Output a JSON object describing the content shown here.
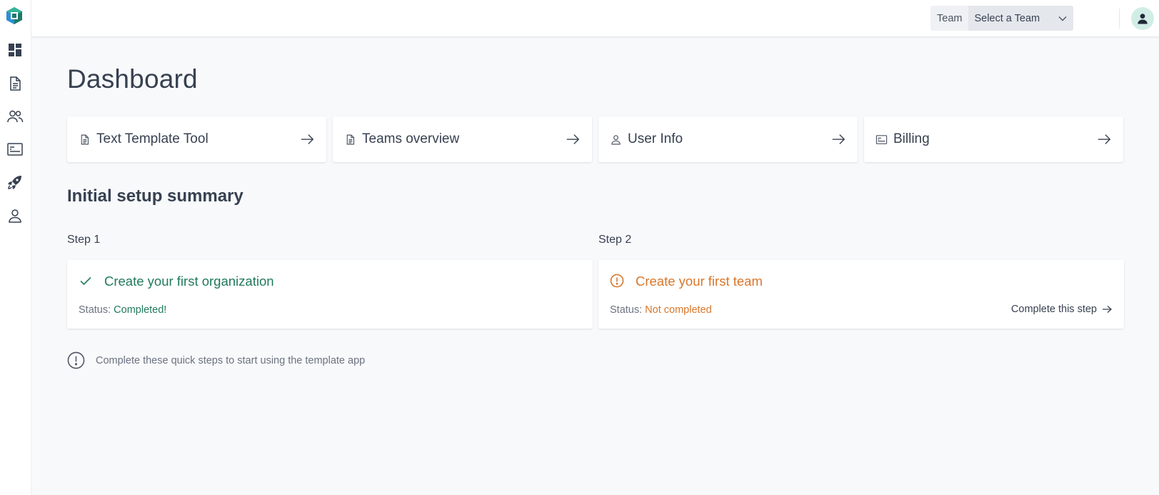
{
  "header": {
    "team_label": "Team",
    "team_select_value": "Select a Team"
  },
  "sidebar": {
    "items": [
      {
        "icon": "dashboard-icon"
      },
      {
        "icon": "document-icon"
      },
      {
        "icon": "users-icon"
      },
      {
        "icon": "billing-icon"
      },
      {
        "icon": "rocket-icon"
      },
      {
        "icon": "user-icon"
      }
    ]
  },
  "main": {
    "title": "Dashboard",
    "quick_links": [
      {
        "label": "Text Template Tool",
        "icon": "document-icon"
      },
      {
        "label": "Teams overview",
        "icon": "document-icon"
      },
      {
        "label": "User Info",
        "icon": "user-icon"
      },
      {
        "label": "Billing",
        "icon": "billing-icon"
      }
    ],
    "setup_title": "Initial setup summary",
    "steps": [
      {
        "label": "Step 1",
        "title": "Create your first organization",
        "status_prefix": "Status: ",
        "status_value": "Completed!",
        "icon": "check-icon"
      },
      {
        "label": "Step 2",
        "title": "Create your first team",
        "status_prefix": "Status: ",
        "status_value": "Not completed",
        "action_label": "Complete this step",
        "icon": "warning-circle-icon"
      }
    ],
    "hint": "Complete these quick steps to start using the template app"
  },
  "colors": {
    "success": "#217a5b",
    "warning": "#d8762a",
    "text": "#374151",
    "background": "#f8f9fb"
  }
}
